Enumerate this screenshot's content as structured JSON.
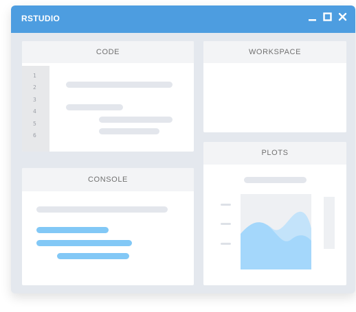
{
  "window": {
    "title": "RSTUDIO",
    "controls": [
      "minimize-icon",
      "maximize-icon",
      "close-icon"
    ]
  },
  "panels": {
    "code": {
      "title": "CODE",
      "line_numbers": [
        "1",
        "2",
        "3",
        "4",
        "5",
        "6"
      ]
    },
    "workspace": {
      "title": "WORKSPACE"
    },
    "console": {
      "title": "CONSOLE"
    },
    "plots": {
      "title": "PLOTS"
    }
  },
  "colors": {
    "titlebar": "#4d9de0",
    "accent_blue": "#82c8f6",
    "placeholder_gray": "#e3e6ec",
    "window_bg": "#e4e8ee"
  }
}
